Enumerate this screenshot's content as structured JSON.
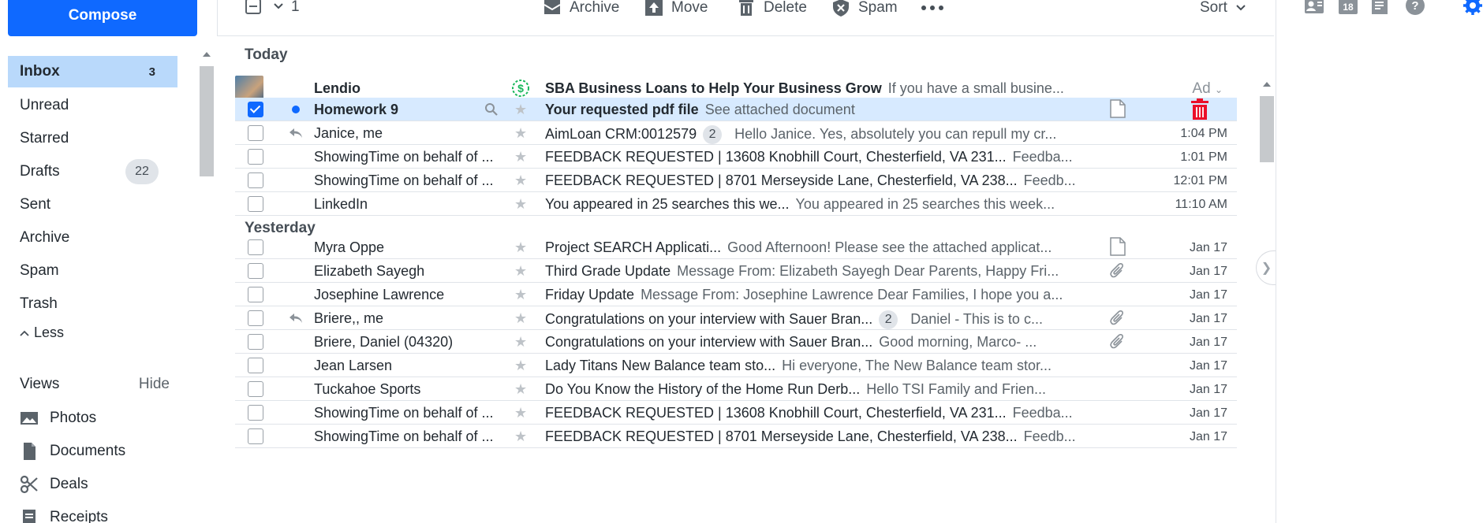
{
  "sidebar": {
    "compose_label": "Compose",
    "folders": [
      {
        "label": "Inbox",
        "count": "3"
      },
      {
        "label": "Unread"
      },
      {
        "label": "Starred"
      },
      {
        "label": "Drafts",
        "count": "22"
      },
      {
        "label": "Sent"
      },
      {
        "label": "Archive"
      },
      {
        "label": "Spam"
      },
      {
        "label": "Trash"
      }
    ],
    "less_label": "Less",
    "views_label": "Views",
    "hide_label": "Hide",
    "views": [
      {
        "label": "Photos",
        "icon": "photos-icon"
      },
      {
        "label": "Documents",
        "icon": "document-icon"
      },
      {
        "label": "Deals",
        "icon": "scissors-icon"
      },
      {
        "label": "Receipts",
        "icon": "receipt-icon"
      }
    ]
  },
  "toolbar": {
    "selected_count": "1",
    "archive": "Archive",
    "move": "Move",
    "delete": "Delete",
    "spam": "Spam",
    "sort": "Sort"
  },
  "rail": {
    "calendar_day": "18"
  },
  "messages": {
    "today_label": "Today",
    "yesterday_label": "Yesterday",
    "ad": {
      "sender": "Lendio",
      "subject": "SBA Business Loans to Help Your Business Grow",
      "snippet": "If you have a small busine...",
      "ad_label": "Ad"
    },
    "today": [
      {
        "sender": "Homework 9",
        "subject": "Your requested pdf file",
        "snippet": "See attached document",
        "time": "",
        "unread": true,
        "selected": true
      },
      {
        "sender": "Janice, me",
        "subject": "AimLoan CRM:0012579",
        "badge": "2",
        "snippet": "Hello Janice. Yes, absolutely you can repull my cr...",
        "time": "1:04 PM",
        "replied": true
      },
      {
        "sender": "ShowingTime on behalf of ...",
        "subject": "FEEDBACK REQUESTED | 13608 Knobhill Court, Chesterfield, VA 231...",
        "snippet": "Feedba...",
        "time": "1:01 PM"
      },
      {
        "sender": "ShowingTime on behalf of ...",
        "subject": "FEEDBACK REQUESTED | 8701 Merseyside Lane, Chesterfield, VA 238...",
        "snippet": "Feedb...",
        "time": "12:01 PM"
      },
      {
        "sender": "LinkedIn",
        "subject": "You appeared in 25 searches this we...",
        "snippet": "You appeared in 25 searches this week...",
        "time": "11:10 AM"
      }
    ],
    "yesterday": [
      {
        "sender": "Myra Oppe",
        "subject": "Project SEARCH Applicati...",
        "snippet": "Good Afternoon! Please see the attached applicat...",
        "time": "Jan 17",
        "attach": "document"
      },
      {
        "sender": "Elizabeth Sayegh",
        "subject": "Third Grade Update",
        "snippet": "Message From: Elizabeth Sayegh Dear Parents, Happy Fri...",
        "time": "Jan 17",
        "attach": "clip"
      },
      {
        "sender": "Josephine Lawrence",
        "subject": "Friday Update",
        "snippet": "Message From: Josephine Lawrence Dear Families, I hope you a...",
        "time": "Jan 17"
      },
      {
        "sender": "Briere,, me",
        "subject": "Congratulations on your interview with Sauer Bran...",
        "badge": "2",
        "snippet": "Daniel - This is to c...",
        "time": "Jan 17",
        "attach": "clip",
        "replied": true
      },
      {
        "sender": "Briere, Daniel (04320)",
        "subject": "Congratulations on your interview with Sauer Bran...",
        "snippet": "Good morning, Marco- ...",
        "time": "Jan 17",
        "attach": "clip"
      },
      {
        "sender": "Jean Larsen",
        "subject": "Lady Titans New Balance team sto...",
        "snippet": "Hi everyone, The New Balance team stor...",
        "time": "Jan 17"
      },
      {
        "sender": "Tuckahoe Sports",
        "subject": "Do You Know the History of the Home Run Derb...",
        "snippet": "Hello TSI Family and Frien...",
        "time": "Jan 17"
      },
      {
        "sender": "ShowingTime on behalf of ...",
        "subject": "FEEDBACK REQUESTED | 13608 Knobhill Court, Chesterfield, VA 231...",
        "snippet": "Feedba...",
        "time": "Jan 17"
      },
      {
        "sender": "ShowingTime on behalf of ...",
        "subject": "FEEDBACK REQUESTED | 8701 Merseyside Lane, Chesterfield, VA 238...",
        "snippet": "Feedb...",
        "time": "Jan 17"
      }
    ]
  },
  "colors": {
    "accent": "#0f69ff",
    "selected_row": "#d7eaff",
    "active_folder": "#b9d9fb",
    "delete_red": "#eb0f29",
    "sponsor_green": "#1ab85c"
  }
}
